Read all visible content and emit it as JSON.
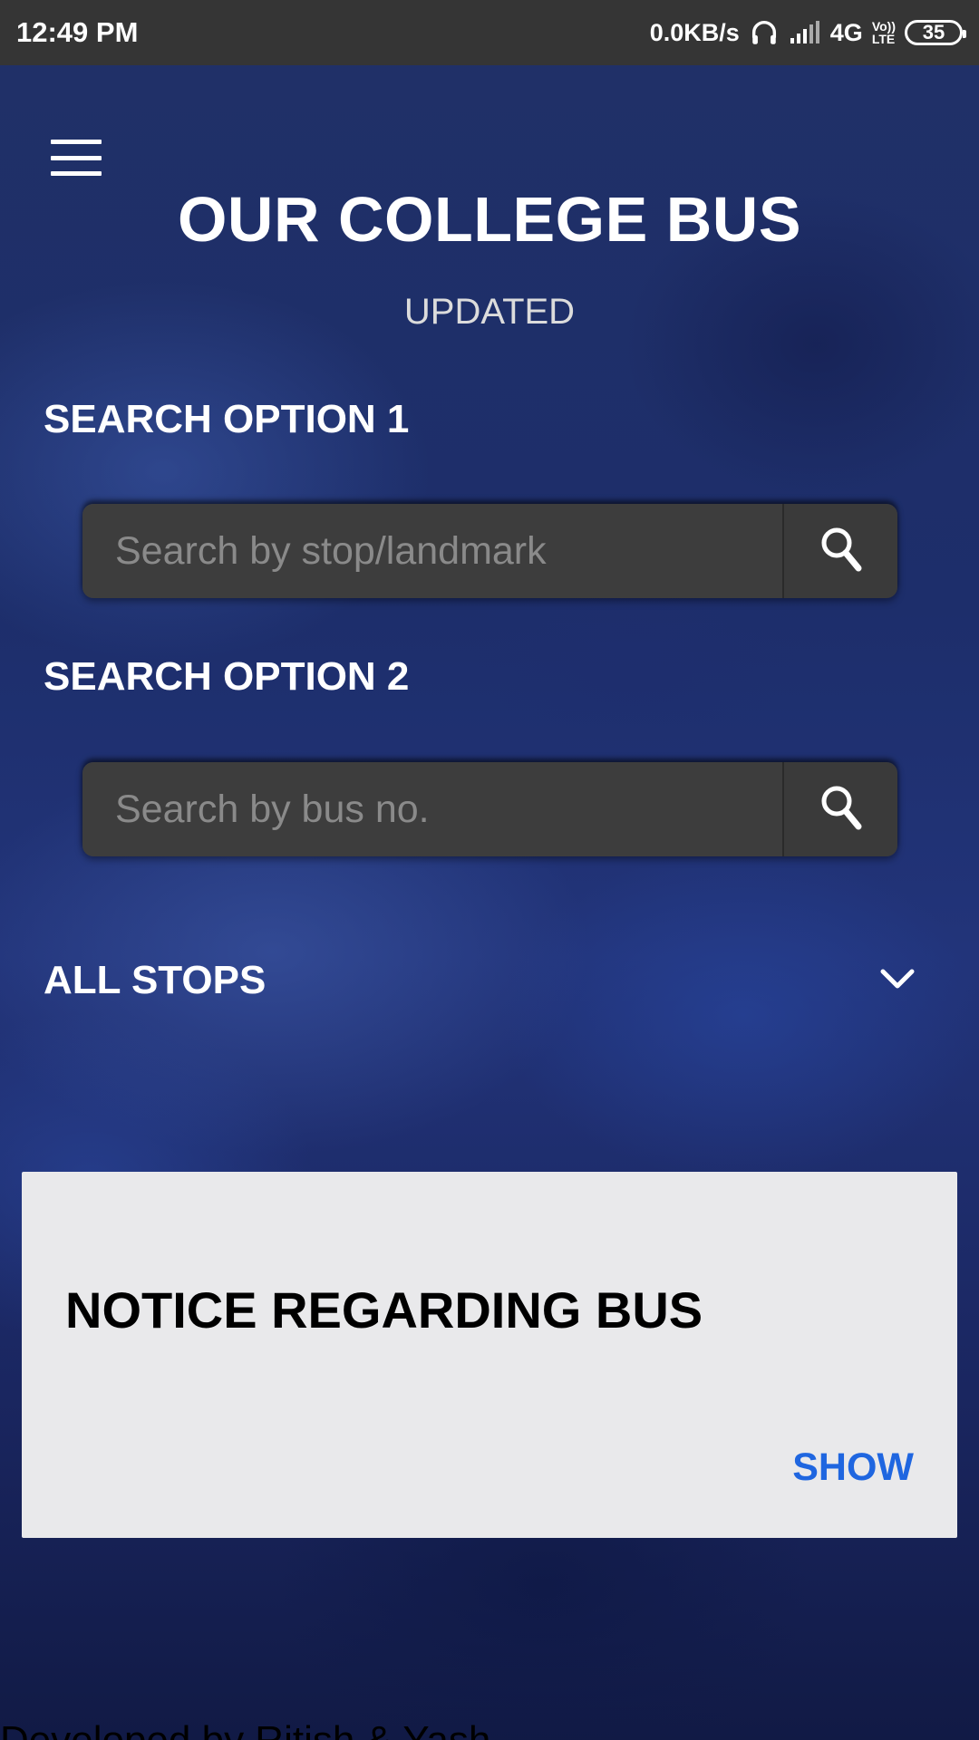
{
  "status_bar": {
    "time": "12:49 PM",
    "network_speed": "0.0KB/s",
    "network_type": "4G",
    "volte_top": "Vo))",
    "volte_bottom": "LTE",
    "battery": "35"
  },
  "header": {
    "title": "OUR COLLEGE BUS",
    "subtitle": "UPDATED"
  },
  "search_option_1": {
    "label": "SEARCH OPTION 1",
    "placeholder": "Search by stop/landmark",
    "value": ""
  },
  "search_option_2": {
    "label": "SEARCH OPTION 2",
    "placeholder": "Search by bus no.",
    "value": ""
  },
  "all_stops": {
    "label": "ALL STOPS"
  },
  "notice": {
    "title": "NOTICE REGARDING BUS",
    "action_label": "SHOW"
  },
  "footer": {
    "text": "Developed by Ritish & Yash"
  },
  "colors": {
    "status_bar": "#353535",
    "background": "#1d2e6b",
    "search_field": "#3d3d3d",
    "card": "#e9e9eb",
    "link": "#1f66e0"
  },
  "icons": [
    "menu-icon",
    "search-icon",
    "chevron-down-icon",
    "headphones-icon",
    "signal-icon",
    "battery-icon"
  ]
}
